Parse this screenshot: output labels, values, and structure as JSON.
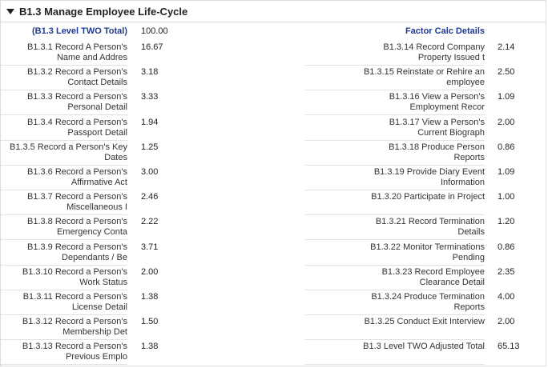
{
  "section": {
    "title": "B1.3 Manage Employee Life-Cycle"
  },
  "header_row": {
    "left_label": "(B1.3 Level TWO Total)",
    "left_value": "100.00",
    "right_label": "Factor Calc Details",
    "right_value": ""
  },
  "rows": [
    {
      "left_label": "B1.3.1 Record A Person's\nName and Addres",
      "left_value": "16.67",
      "right_label": "B1.3.14 Record Company\nProperty Issued t",
      "right_value": "2.14"
    },
    {
      "left_label": "B1.3.2 Record a Person's\nContact Details",
      "left_value": "3.18",
      "right_label": "B1.3.15 Reinstate or Rehire an\nemployee",
      "right_value": "2.50"
    },
    {
      "left_label": "B1.3.3 Record a Person's\nPersonal Detail",
      "left_value": "3.33",
      "right_label": "B1.3.16 View a Person's\nEmployment Recor",
      "right_value": "1.09"
    },
    {
      "left_label": "B1.3.4 Record a Person's\nPassport Detail",
      "left_value": "1.94",
      "right_label": "B1.3.17 View a Person's\nCurrent Biograph",
      "right_value": "2.00"
    },
    {
      "left_label": "B1.3.5 Record a Person's Key\nDates",
      "left_value": "1.25",
      "right_label": "B1.3.18 Produce Person\nReports",
      "right_value": "0.86"
    },
    {
      "left_label": "B1.3.6 Record a Person's\nAffirmative Act",
      "left_value": "3.00",
      "right_label": "B1.3.19 Provide Diary Event\nInformation",
      "right_value": "1.09"
    },
    {
      "left_label": "B1.3.7 Record a Person's\nMiscellaneous I",
      "left_value": "2.46",
      "right_label": "B1.3.20 Participate in Project",
      "right_value": "1.00"
    },
    {
      "left_label": "B1.3.8 Record a Person's\nEmergency Conta",
      "left_value": "2.22",
      "right_label": "B1.3.21 Record Termination\nDetails",
      "right_value": "1.20"
    },
    {
      "left_label": "B1.3.9 Record a Person's\nDependants / Be",
      "left_value": "3.71",
      "right_label": "B1.3.22 Monitor Terminations\nPending",
      "right_value": "0.86"
    },
    {
      "left_label": "B1.3.10 Record a Person's\nWork Status",
      "left_value": "2.00",
      "right_label": "B1.3.23 Record Employee\nClearance Detail",
      "right_value": "2.35"
    },
    {
      "left_label": "B1.3.11 Record a Person's\nLicense Detail",
      "left_value": "1.38",
      "right_label": "B1.3.24 Produce Termination\nReports",
      "right_value": "4.00"
    },
    {
      "left_label": "B1.3.12 Record a Person's\nMembership Det",
      "left_value": "1.50",
      "right_label": "B1.3.25 Conduct Exit Interview",
      "right_value": "2.00"
    },
    {
      "left_label": "B1.3.13 Record a Person's\nPrevious Emplo",
      "left_value": "1.38",
      "right_label": "B1.3 Level TWO Adjusted Total",
      "right_value": "65.13"
    }
  ],
  "colors": {
    "accent_blue": "#1f3a93",
    "border": "#dcdcdc"
  },
  "icons": {
    "toggle": "triangle-down-icon"
  }
}
